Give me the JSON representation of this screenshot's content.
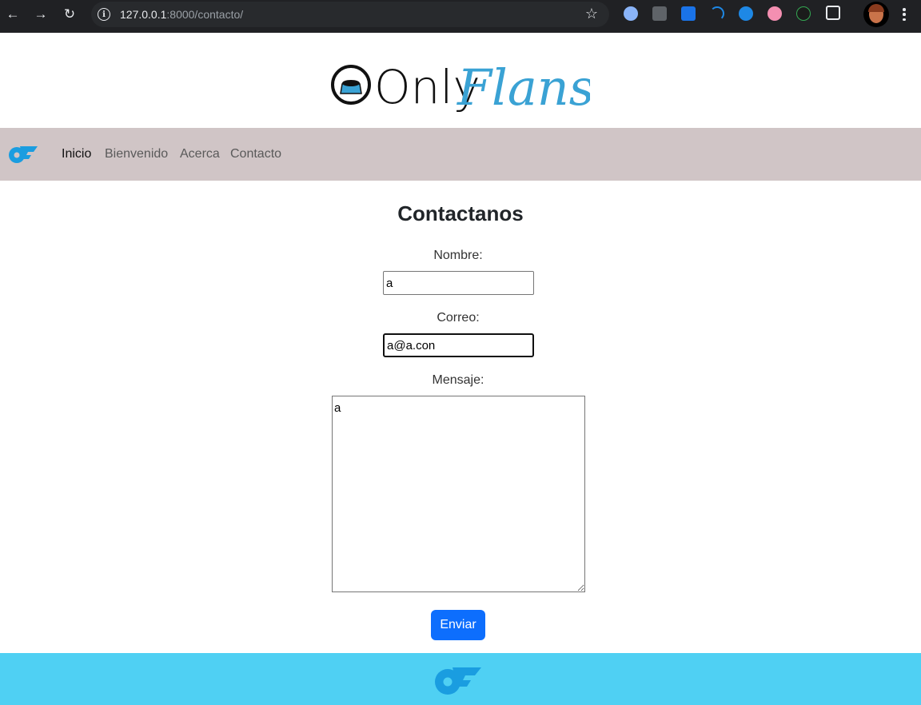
{
  "browser": {
    "url_host": "127.0.0.1",
    "url_path": ":8000/contacto/"
  },
  "brand": {
    "logo_text_1": "Only",
    "logo_text_2": "Flans"
  },
  "nav": {
    "items": [
      {
        "label": "Inicio",
        "active": true
      },
      {
        "label": "Bienvenido",
        "active": false
      },
      {
        "label": "Acerca",
        "active": false
      },
      {
        "label": "Contacto",
        "active": false
      }
    ]
  },
  "form": {
    "title": "Contactanos",
    "name_label": "Nombre:",
    "name_value": "a",
    "email_label": "Correo:",
    "email_value": "a@a.con",
    "message_label": "Mensaje:",
    "message_value": "a",
    "submit_label": "Enviar"
  },
  "colors": {
    "navbar_bg": "#d0c5c6",
    "footer_bg": "#4fd0f3",
    "button_bg": "#0d6efd",
    "logo_accent": "#3aa2d4"
  }
}
